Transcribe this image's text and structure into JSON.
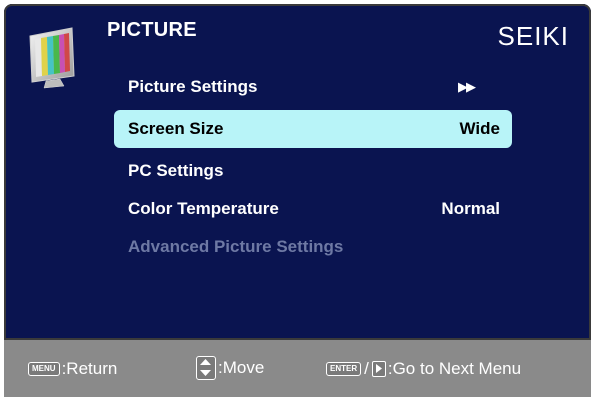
{
  "header": {
    "title": "PICTURE",
    "brand": "SEIKI",
    "icon": "monitor-test-pattern-icon"
  },
  "menu": {
    "items": [
      {
        "label": "Picture Settings",
        "value": "▶▶",
        "state": "normal"
      },
      {
        "label": "Screen Size",
        "value": "Wide",
        "state": "selected"
      },
      {
        "label": "PC Settings",
        "value": "",
        "state": "normal"
      },
      {
        "label": "Color Temperature",
        "value": "Normal",
        "state": "normal"
      },
      {
        "label": "Advanced Picture Settings",
        "value": "",
        "state": "disabled"
      }
    ]
  },
  "footer": {
    "menu_key": "MENU",
    "return_label": ":Return",
    "move_label": ":Move",
    "enter_key": "ENTER",
    "slash": "/",
    "next_label": ":Go to Next Menu"
  },
  "colors": {
    "background": "#0a1450",
    "selected_bg": "#b8f4f8",
    "footer_bg": "#8a8a8a",
    "disabled_text": "#6e79a4"
  }
}
